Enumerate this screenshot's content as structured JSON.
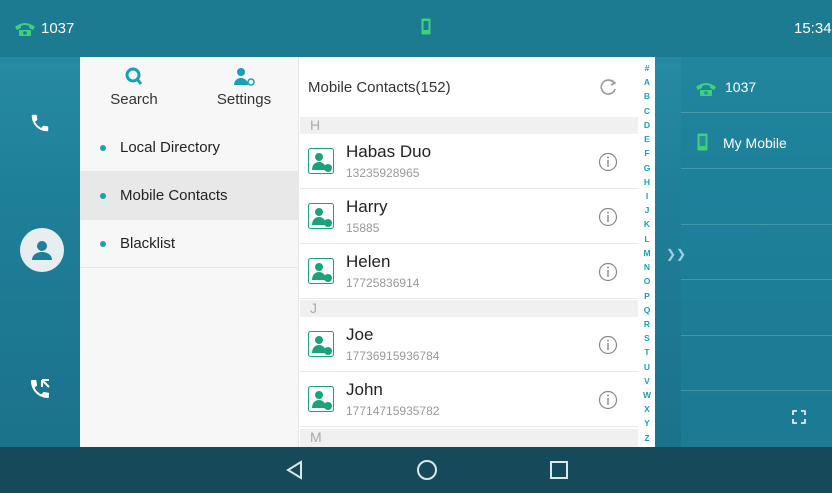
{
  "status_bar": {
    "extension": "1037",
    "time": "15:34"
  },
  "menu": {
    "search_label": "Search",
    "settings_label": "Settings",
    "items": [
      {
        "label": "Local Directory",
        "active": false
      },
      {
        "label": "Mobile Contacts",
        "active": true
      },
      {
        "label": "Blacklist",
        "active": false
      }
    ]
  },
  "contacts": {
    "title": "Mobile Contacts(152)",
    "groups": [
      {
        "letter": "H",
        "entries": [
          {
            "name": "Habas Duo",
            "number": "13235928965"
          },
          {
            "name": "Harry",
            "number": "15885"
          },
          {
            "name": "Helen",
            "number": "17725836914"
          }
        ]
      },
      {
        "letter": "J",
        "entries": [
          {
            "name": "Joe",
            "number": "17736915936784"
          },
          {
            "name": "John",
            "number": "17714715935782"
          }
        ]
      },
      {
        "letter": "M",
        "entries": []
      }
    ],
    "alphabet": [
      "#",
      "A",
      "B",
      "C",
      "D",
      "E",
      "F",
      "G",
      "H",
      "I",
      "J",
      "K",
      "L",
      "M",
      "N",
      "O",
      "P",
      "Q",
      "R",
      "S",
      "T",
      "U",
      "V",
      "W",
      "X",
      "Y",
      "Z"
    ]
  },
  "right_panel": {
    "line_label": "1037",
    "mobile_label": "My Mobile"
  },
  "colors": {
    "accent": "#19a0b8",
    "teal_bg": "#1f7f99",
    "avatar_green": "#1aa37a"
  }
}
